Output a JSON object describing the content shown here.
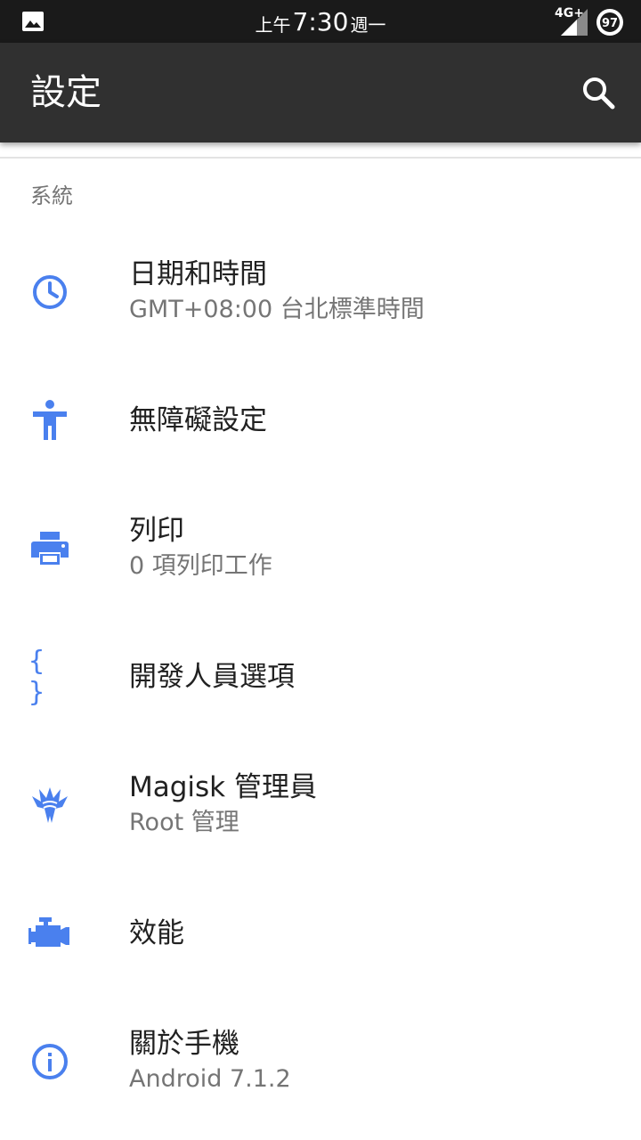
{
  "colors": {
    "accent": "#4a80ee",
    "statusbar_bg": "#1a1a1a",
    "appbar_bg": "#303030"
  },
  "statusbar": {
    "left_icon": "image-icon",
    "ampm": "上午",
    "time": "7:30",
    "weekday": "週一",
    "network": "4G+",
    "battery": "97"
  },
  "appbar": {
    "title": "設定",
    "search_icon": "search-icon"
  },
  "section": {
    "header": "系統"
  },
  "items": [
    {
      "icon": "clock-icon",
      "title": "日期和時間",
      "summary": "GMT+08:00 台北標準時間"
    },
    {
      "icon": "accessibility-icon",
      "title": "無障礙設定",
      "summary": ""
    },
    {
      "icon": "printer-icon",
      "title": "列印",
      "summary": "0 項列印工作"
    },
    {
      "icon": "braces-icon",
      "title": "開發人員選項",
      "summary": "",
      "icon_text": "{ }"
    },
    {
      "icon": "magisk-icon",
      "title": "Magisk 管理員",
      "summary": "Root 管理"
    },
    {
      "icon": "engine-icon",
      "title": "效能",
      "summary": ""
    },
    {
      "icon": "info-icon",
      "title": "關於手機",
      "summary": "Android 7.1.2"
    }
  ]
}
